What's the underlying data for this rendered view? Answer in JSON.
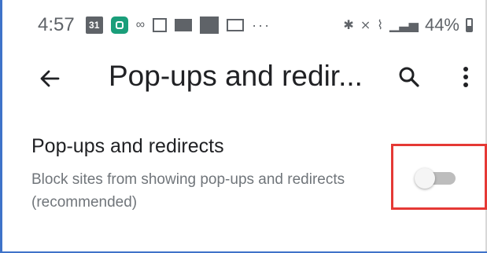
{
  "status_bar": {
    "time": "4:57",
    "calendar_day": "31",
    "overflow": "···",
    "battery_percent": "44%"
  },
  "app_bar": {
    "title": "Pop-ups and redir..."
  },
  "setting": {
    "title": "Pop-ups and redirects",
    "description": "Block sites from showing pop-ups and redirects (recommended)",
    "enabled": false
  },
  "colors": {
    "highlight": "#e53935",
    "frame": "#3f73c9"
  },
  "icons": [
    "back-arrow-icon",
    "search-icon",
    "more-vert-icon"
  ]
}
